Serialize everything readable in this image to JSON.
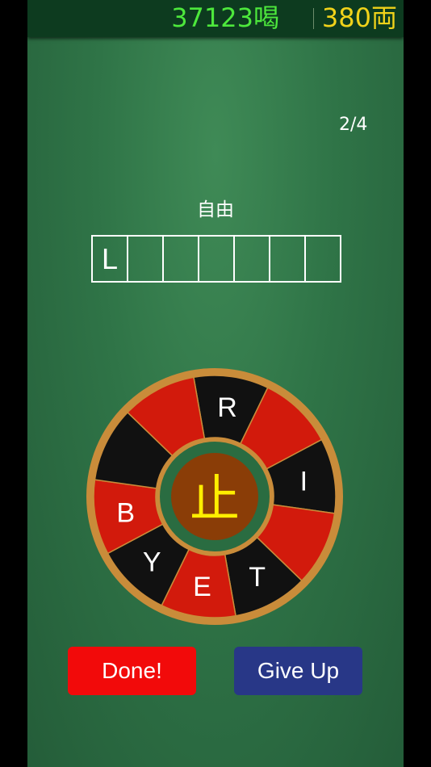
{
  "header": {
    "score": "37123喝",
    "money": "380両"
  },
  "progress": "2/4",
  "clue": "自由",
  "answer_slots": [
    "L",
    "",
    "",
    "",
    "",
    "",
    ""
  ],
  "wheel": {
    "center": "止",
    "segments": [
      {
        "letter": "R",
        "color": "#111111"
      },
      {
        "letter": "",
        "color": "#d21a0c"
      },
      {
        "letter": "I",
        "color": "#111111"
      },
      {
        "letter": "",
        "color": "#d21a0c"
      },
      {
        "letter": "T",
        "color": "#111111"
      },
      {
        "letter": "E",
        "color": "#d21a0c"
      },
      {
        "letter": "Y",
        "color": "#111111"
      },
      {
        "letter": "B",
        "color": "#d21a0c"
      },
      {
        "letter": "",
        "color": "#111111"
      },
      {
        "letter": "",
        "color": "#d21a0c"
      }
    ]
  },
  "buttons": {
    "done": "Done!",
    "give_up": "Give Up"
  }
}
